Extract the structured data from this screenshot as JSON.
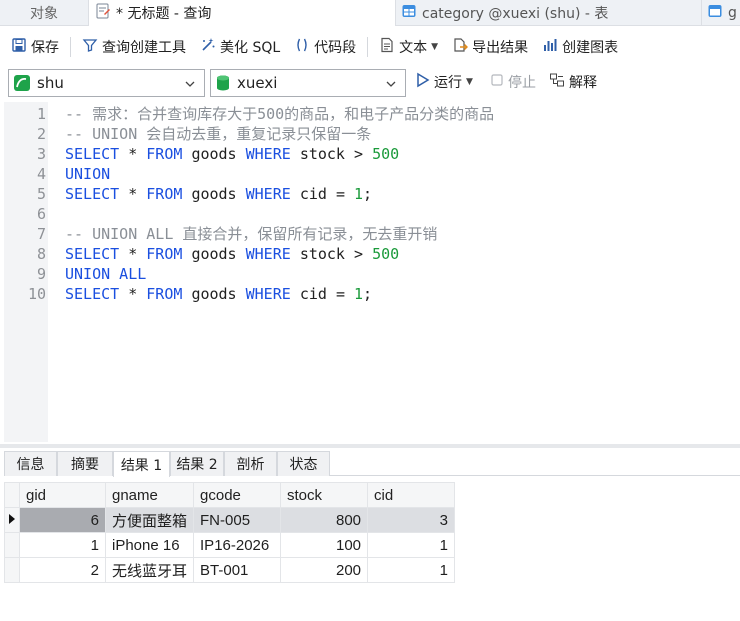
{
  "tabs": {
    "objects": "对象",
    "query": "* 无标题 - 查询",
    "category": "category @xuexi (shu) - 表",
    "more": "g"
  },
  "toolbar": {
    "save": "保存",
    "query_builder": "查询创建工具",
    "beautify_sql": "美化 SQL",
    "code_snippet": "代码段",
    "text": "文本",
    "export_result": "导出结果",
    "create_chart": "创建图表"
  },
  "connection": {
    "name": "shu",
    "database": "xuexi",
    "run": "运行",
    "stop": "停止",
    "explain": "解释"
  },
  "editor": {
    "lines": [
      {
        "num": "1",
        "text": "-- 需求：合并查询库存大于500的商品，和电子产品分类的商品"
      },
      {
        "num": "2",
        "text": "-- UNION 会自动去重，重复记录只保留一条"
      },
      {
        "num": "3",
        "text": "SELECT * FROM goods WHERE stock > 500"
      },
      {
        "num": "4",
        "text": "UNION"
      },
      {
        "num": "5",
        "text": "SELECT * FROM goods WHERE cid = 1;"
      },
      {
        "num": "6",
        "text": ""
      },
      {
        "num": "7",
        "text": "-- UNION ALL 直接合并，保留所有记录，无去重开销"
      },
      {
        "num": "8",
        "text": "SELECT * FROM goods WHERE stock > 500"
      },
      {
        "num": "9",
        "text": "UNION ALL"
      },
      {
        "num": "10",
        "text": "SELECT * FROM goods WHERE cid = 1;"
      }
    ]
  },
  "result_tabs": [
    "信息",
    "摘要",
    "结果 1",
    "结果 2",
    "剖析",
    "状态"
  ],
  "result_tabs_active": "结果 1",
  "grid": {
    "columns": [
      "gid",
      "gname",
      "gcode",
      "stock",
      "cid"
    ],
    "rows": [
      [
        "6",
        "方便面整箱",
        "FN-005",
        "800",
        "3"
      ],
      [
        "1",
        "iPhone 16",
        "IP16-2026",
        "100",
        "1"
      ],
      [
        "2",
        "无线蓝牙耳",
        "BT-001",
        "200",
        "1"
      ]
    ]
  },
  "colors": {
    "keyword": "#1a4fe0",
    "comment": "#8a8f96",
    "number": "#1a9a3a"
  }
}
